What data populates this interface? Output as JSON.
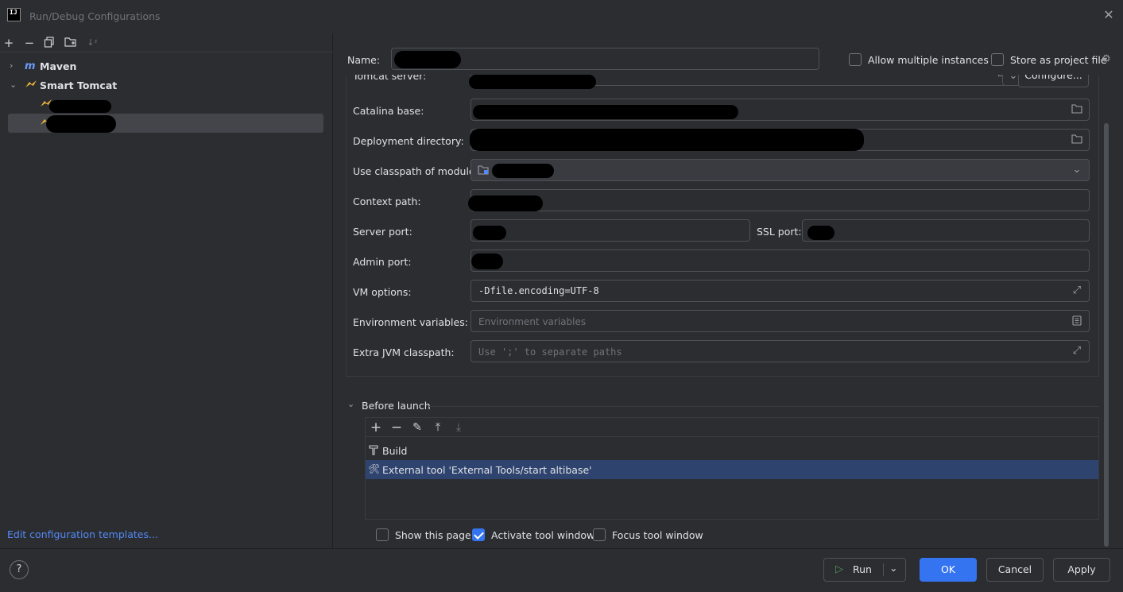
{
  "window": {
    "title": "Run/Debug Configurations",
    "app_icon_text": "IJ"
  },
  "left_toolbar": {
    "icons": [
      "add-icon",
      "remove-icon",
      "copy-icon",
      "new-folder-icon",
      "sort-icon"
    ]
  },
  "tree": {
    "items": [
      {
        "label": "Maven",
        "icon": "maven-icon",
        "expanded": false
      },
      {
        "label": "Smart Tomcat",
        "icon": "tomcat-icon",
        "expanded": true
      }
    ]
  },
  "edit_templates_link": "Edit configuration templates...",
  "form": {
    "name_label": "Name:",
    "allow_multiple_label": "Allow multiple instances",
    "store_project_label": "Store as project file",
    "tomcat_server_label": "Tomcat server:",
    "configure_label": "Configure...",
    "catalina_base_label": "Catalina base:",
    "deployment_dir_label": "Deployment directory:",
    "classpath_module_label": "Use classpath of module:",
    "context_path_label": "Context path:",
    "server_port_label": "Server port:",
    "ssl_port_label": "SSL port:",
    "admin_port_label": "Admin port:",
    "vm_options_label": "VM options:",
    "vm_options_value": "-Dfile.encoding=UTF-8",
    "env_vars_label": "Environment variables:",
    "env_vars_placeholder": "Environment variables",
    "extra_jvm_label": "Extra JVM classpath:",
    "extra_jvm_placeholder": "Use ';' to separate paths"
  },
  "before_launch": {
    "title": "Before launch",
    "items": [
      {
        "label": "Build",
        "icon": "build-hammer-icon"
      },
      {
        "label": "External tool 'External Tools/start altibase'",
        "icon": "external-tool-icon"
      }
    ],
    "show_page_label": "Show this page",
    "activate_tool_label": "Activate tool window",
    "focus_tool_label": "Focus tool window",
    "show_page_checked": false,
    "activate_tool_checked": true,
    "focus_tool_checked": false
  },
  "footer": {
    "help_label": "?",
    "run_label": "Run",
    "ok_label": "OK",
    "cancel_label": "Cancel",
    "apply_label": "Apply"
  },
  "colors": {
    "accent": "#3574f0",
    "link": "#548af7",
    "selection": "#2e436e",
    "background": "#2b2d30"
  }
}
